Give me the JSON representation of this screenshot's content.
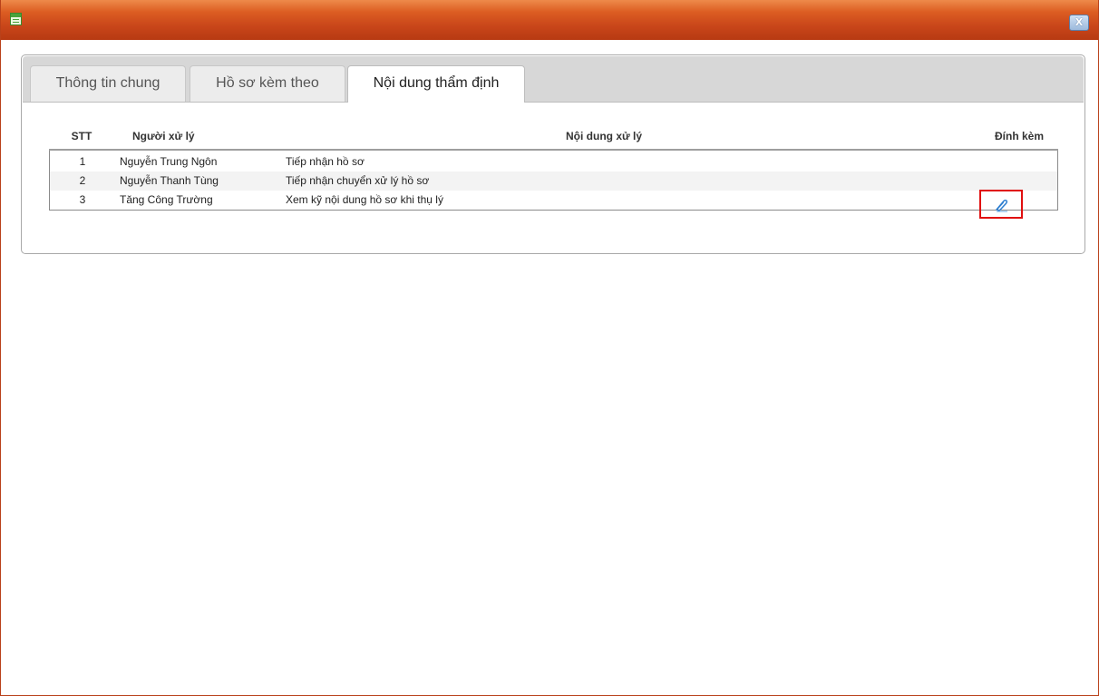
{
  "window": {
    "title": "",
    "icon": "dialog-app-icon",
    "close_label": "X"
  },
  "tabs": [
    {
      "label": "Thông tin chung",
      "active": false
    },
    {
      "label": "Hồ sơ kèm theo",
      "active": false
    },
    {
      "label": "Nội dung thẩm định",
      "active": true
    }
  ],
  "grid": {
    "columns": {
      "stt": "STT",
      "user": "Người xử lý",
      "content": "Nội dung xử lý",
      "attach": "Đính kèm"
    },
    "rows": [
      {
        "stt": "1",
        "user": "Nguyễn Trung Ngôn",
        "content": "Tiếp nhận hồ sơ",
        "attachment": false
      },
      {
        "stt": "2",
        "user": "Nguyễn Thanh Tùng",
        "content": "Tiếp nhận chuyển xử lý hồ sơ",
        "attachment": false
      },
      {
        "stt": "3",
        "user": "Tăng Công Trường",
        "content": "Xem kỹ nội dung hồ sơ khi thụ lý",
        "attachment": true,
        "attachment_icon": "paperclip-icon"
      }
    ]
  },
  "colors": {
    "titlebar": "#d4531c",
    "highlight_box": "#e01010",
    "icon_blue": "#2f7fd0"
  }
}
